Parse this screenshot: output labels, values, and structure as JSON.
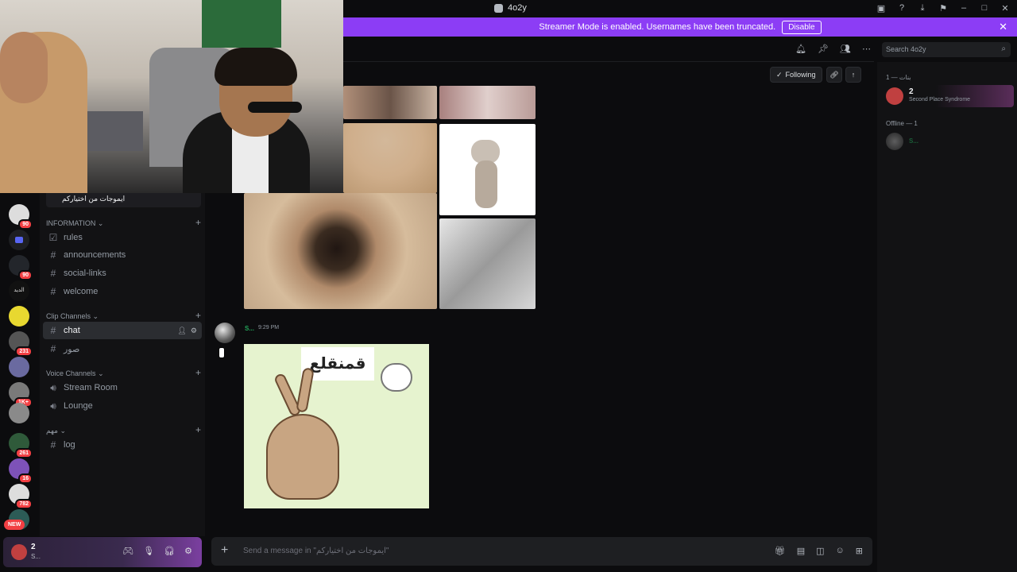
{
  "window": {
    "title": "4o2y"
  },
  "banner": {
    "text": "Streamer Mode is enabled. Usernames have been truncated.",
    "button": "Disable"
  },
  "servers": {
    "badges": [
      "90",
      "90",
      "231",
      "1K+",
      "261",
      "16",
      "782"
    ],
    "text_icon": "الديد",
    "new_label": "NEW"
  },
  "channels": {
    "top_item": "ايموجات من اختياركم",
    "categories": {
      "information": "INFORMATION",
      "clip": "Clip Channels",
      "voice": "Voice Channels",
      "misc": "مهم"
    },
    "list": {
      "rules": "rules",
      "announcements": "announcements",
      "social_links": "social-links",
      "welcome": "welcome",
      "chat": "chat",
      "images": "صور",
      "stream_room": "Stream Room",
      "lounge": "Lounge",
      "log": "log"
    }
  },
  "user": {
    "name": "2",
    "sub": "S..."
  },
  "header": {
    "following": "Following",
    "search_placeholder": "Search 4o2y"
  },
  "message": {
    "author": "S...",
    "time": "9:29 PM",
    "sticker_text": "قمنقلع"
  },
  "composer": {
    "placeholder": "Send a message in \"ايموجات من اختياركم\""
  },
  "members": {
    "group_online": "بنات — 1",
    "online": [
      {
        "name": "2",
        "status": "Second Place Syndrome"
      }
    ],
    "group_offline": "Offline — 1",
    "offline": [
      {
        "name": "S..."
      }
    ]
  },
  "colors": {
    "accent": "#8c3df5",
    "online": "#23a55a",
    "badge": "#f23f43",
    "background": "#0c0c0e"
  },
  "icons": [
    "bell-icon",
    "pin-icon",
    "members-icon",
    "more-icon",
    "search-icon",
    "link-icon",
    "arrow-up-icon",
    "gift-icon",
    "gif-icon",
    "sticker-icon",
    "emoji-icon",
    "apps-icon",
    "mic-icon",
    "headphones-icon",
    "gear-icon",
    "game-icon"
  ]
}
